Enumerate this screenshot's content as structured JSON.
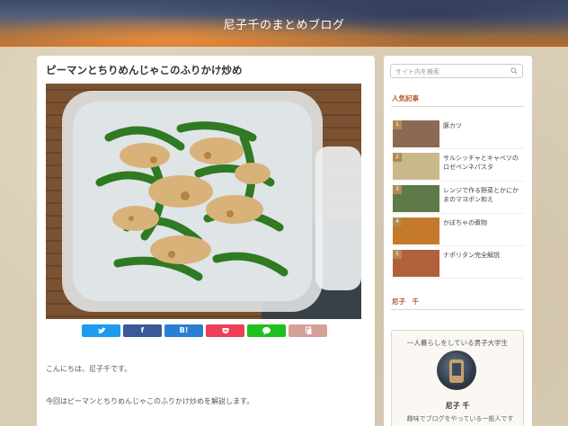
{
  "header": {
    "site_title": "尼子千のまとめブログ"
  },
  "post": {
    "title": "ピーマンとちりめんじゃこのふりかけ炒め",
    "paragraphs": [
      "こんにちは、尼子千です。",
      "今回はピーマンとちりめんじゃこのふりかけ炒めを解説します。"
    ]
  },
  "share": {
    "buttons": [
      {
        "label": "",
        "icon": "twitter-bird-icon",
        "color": "#1d9bf0"
      },
      {
        "label": "f",
        "icon": "facebook-icon",
        "color": "#3b5998"
      },
      {
        "label": "B!",
        "icon": "hatena-bookmark-icon",
        "color": "#2a7fd4"
      },
      {
        "label": "",
        "icon": "pocket-icon",
        "color": "#ef3f56"
      },
      {
        "label": "",
        "icon": "line-icon",
        "color": "#1dc11d"
      },
      {
        "label": "",
        "icon": "copy-icon",
        "color": "#d4a09a"
      }
    ]
  },
  "sidebar": {
    "search_placeholder": "サイト内を検索",
    "popular_title": "人気記事",
    "popular": [
      {
        "rank": "1",
        "title": "豚カツ",
        "thumb_color": "#8a6a52"
      },
      {
        "rank": "2",
        "title": "サルシッチャとキャベツのロゼペンネパスタ",
        "thumb_color": "#c9b88a"
      },
      {
        "rank": "3",
        "title": "レンジで作る野菜とかにかまのマヨポン和え",
        "thumb_color": "#5e7a48"
      },
      {
        "rank": "4",
        "title": "かぼちゃの煮物",
        "thumb_color": "#c47a2a"
      },
      {
        "rank": "5",
        "title": "ナポリタン完全解説",
        "thumb_color": "#b0603a"
      }
    ],
    "author_title": "尼子　千",
    "profile": {
      "tagline": "一人暮らしをしている男子大学生",
      "name": "尼子 千",
      "desc": "趣味でブログをやっている一般人です"
    }
  },
  "colors": {
    "accent": "#b85a30",
    "background": "#d9cdb6"
  }
}
